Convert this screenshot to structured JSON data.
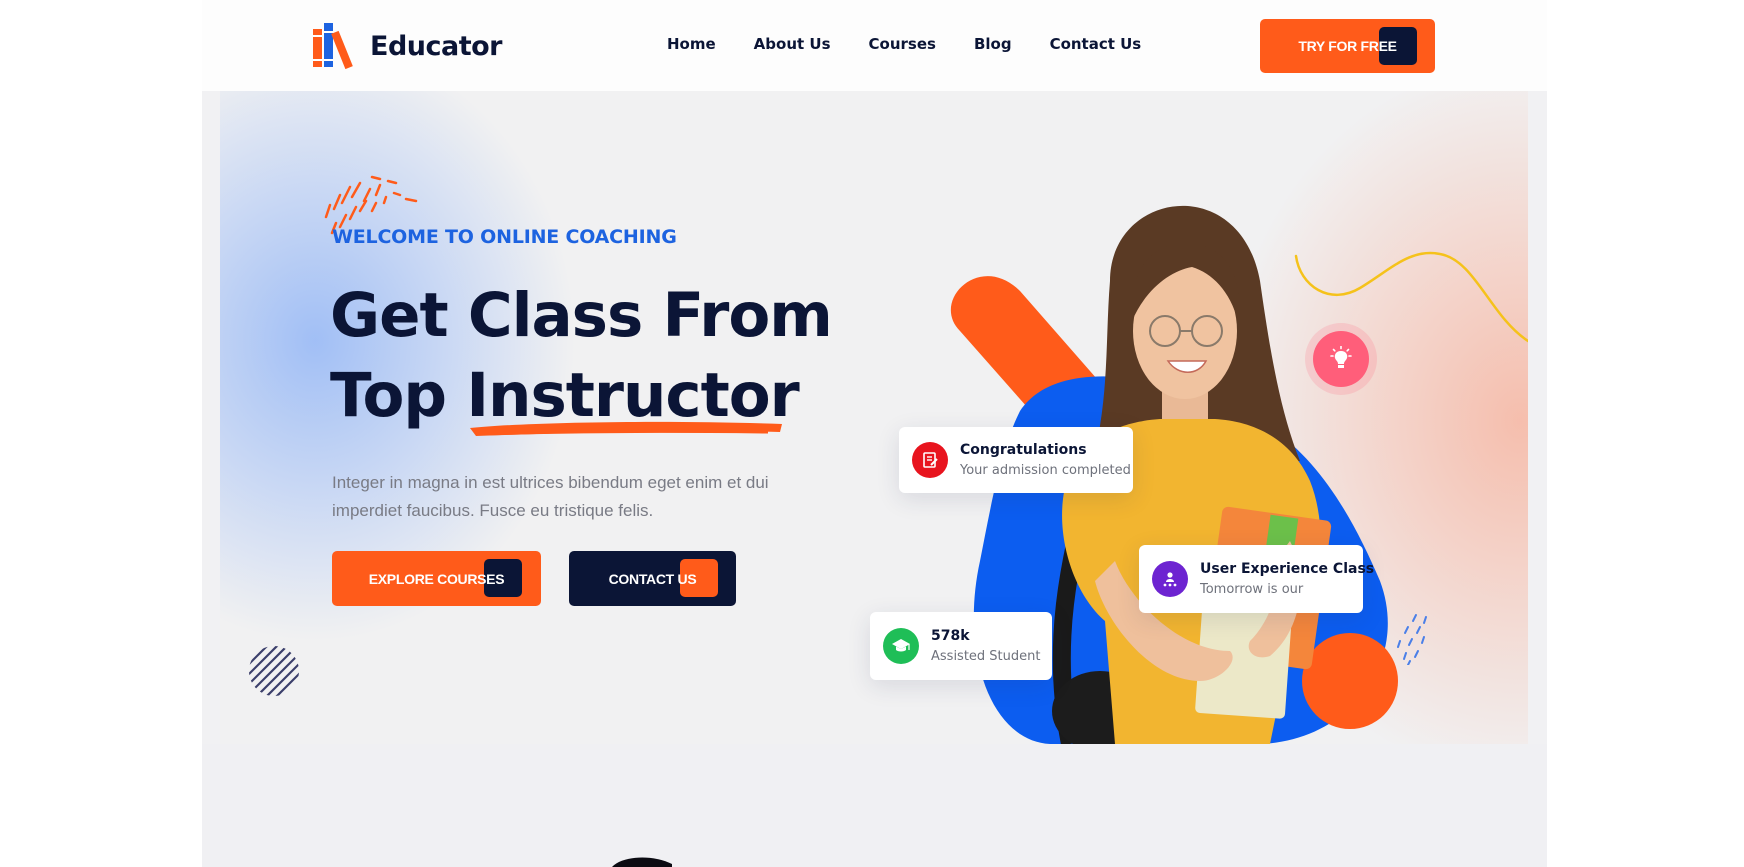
{
  "brand": {
    "name": "Educator",
    "colors": {
      "primary": "#ff5b1a",
      "navy": "#0b1536",
      "blue": "#1d63e0"
    }
  },
  "nav": {
    "items": [
      "Home",
      "About Us",
      "Courses",
      "Blog",
      "Contact Us"
    ]
  },
  "header": {
    "cta_label": "TRY FOR FREE"
  },
  "hero": {
    "kicker": "WELCOME TO ONLINE COACHING",
    "headline_line1": "Get Class From",
    "headline_line2_prefix": "Top ",
    "headline_line2_highlight": "Instructor",
    "description": "Integer in magna in est ultrices bibendum eget enim et dui imperdiet faucibus. Fusce eu tristique felis.",
    "explore_label": "EXPLORE COURSES",
    "contact_label": "CONTACT US"
  },
  "cards": {
    "congrats": {
      "title": "Congratulations",
      "subtitle": "Your admission completed",
      "icon": "admission-icon",
      "color": "#e8141e"
    },
    "ux_class": {
      "title": "User Experience Class",
      "subtitle": "Tomorrow is our",
      "icon": "class-icon",
      "color": "#6d24d1"
    },
    "students": {
      "title": "578k",
      "subtitle": "Assisted Student",
      "icon": "graduation-cap-icon",
      "color": "#1fbe57"
    }
  },
  "icons": {
    "logo": "books-logo-icon",
    "idea": "lightbulb-icon"
  }
}
